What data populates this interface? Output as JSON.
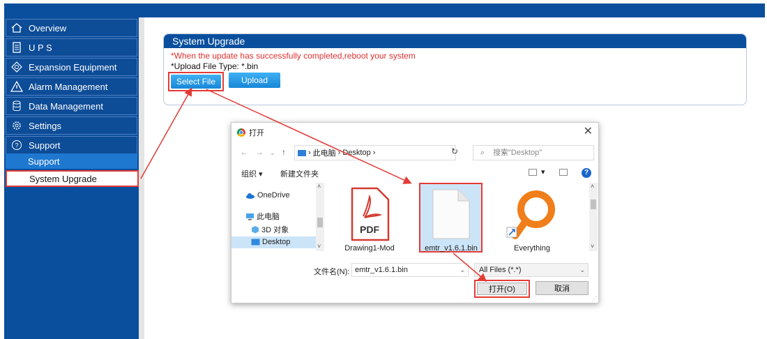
{
  "sidebar": {
    "items": [
      {
        "label": "Overview",
        "icon": "home-icon"
      },
      {
        "label": "U P S",
        "icon": "ups-battery-icon"
      },
      {
        "label": "Expansion Equipment",
        "icon": "expansion-icon"
      },
      {
        "label": "Alarm Management",
        "icon": "alarm-warning-icon"
      },
      {
        "label": "Data Management",
        "icon": "database-icon"
      },
      {
        "label": "Settings",
        "icon": "gear-icon"
      },
      {
        "label": "Support",
        "icon": "help-icon"
      }
    ],
    "sub_items": [
      {
        "label": "Support"
      },
      {
        "label": "System Upgrade"
      }
    ]
  },
  "panel": {
    "title": "System Upgrade",
    "warning": "*When the update has successfully completed,reboot your system",
    "file_type": "*Upload File Type: *.bin",
    "select_label": "Select File",
    "upload_label": "Upload"
  },
  "dialog": {
    "title": "打开",
    "close": "✕",
    "path": [
      "此电脑",
      "Desktop"
    ],
    "search_placeholder": "搜索\"Desktop\"",
    "organize": "组织 ▾",
    "new_folder": "新建文件夹",
    "tree": [
      "OneDrive",
      "此电脑",
      "3D 对象",
      "Desktop"
    ],
    "files": [
      {
        "name": "Drawing1-Mod",
        "icon": "pdf-file-icon",
        "badge": "PDF"
      },
      {
        "name": "emtr_v1.6.1.bin",
        "icon": "blank-file-icon"
      },
      {
        "name": "Everything",
        "icon": "everything-app-icon"
      }
    ],
    "filename_label": "文件名(N):",
    "filename_value": "emtr_v1.6.1.bin",
    "filetype_value": "All Files (*.*)",
    "open_label": "打开(O)",
    "cancel_label": "取消"
  },
  "colors": {
    "brand_blue": "#0a4f9d",
    "button_blue": "#1787d8",
    "highlight_red": "#e23b36",
    "selection_blue": "#cce4f7"
  }
}
